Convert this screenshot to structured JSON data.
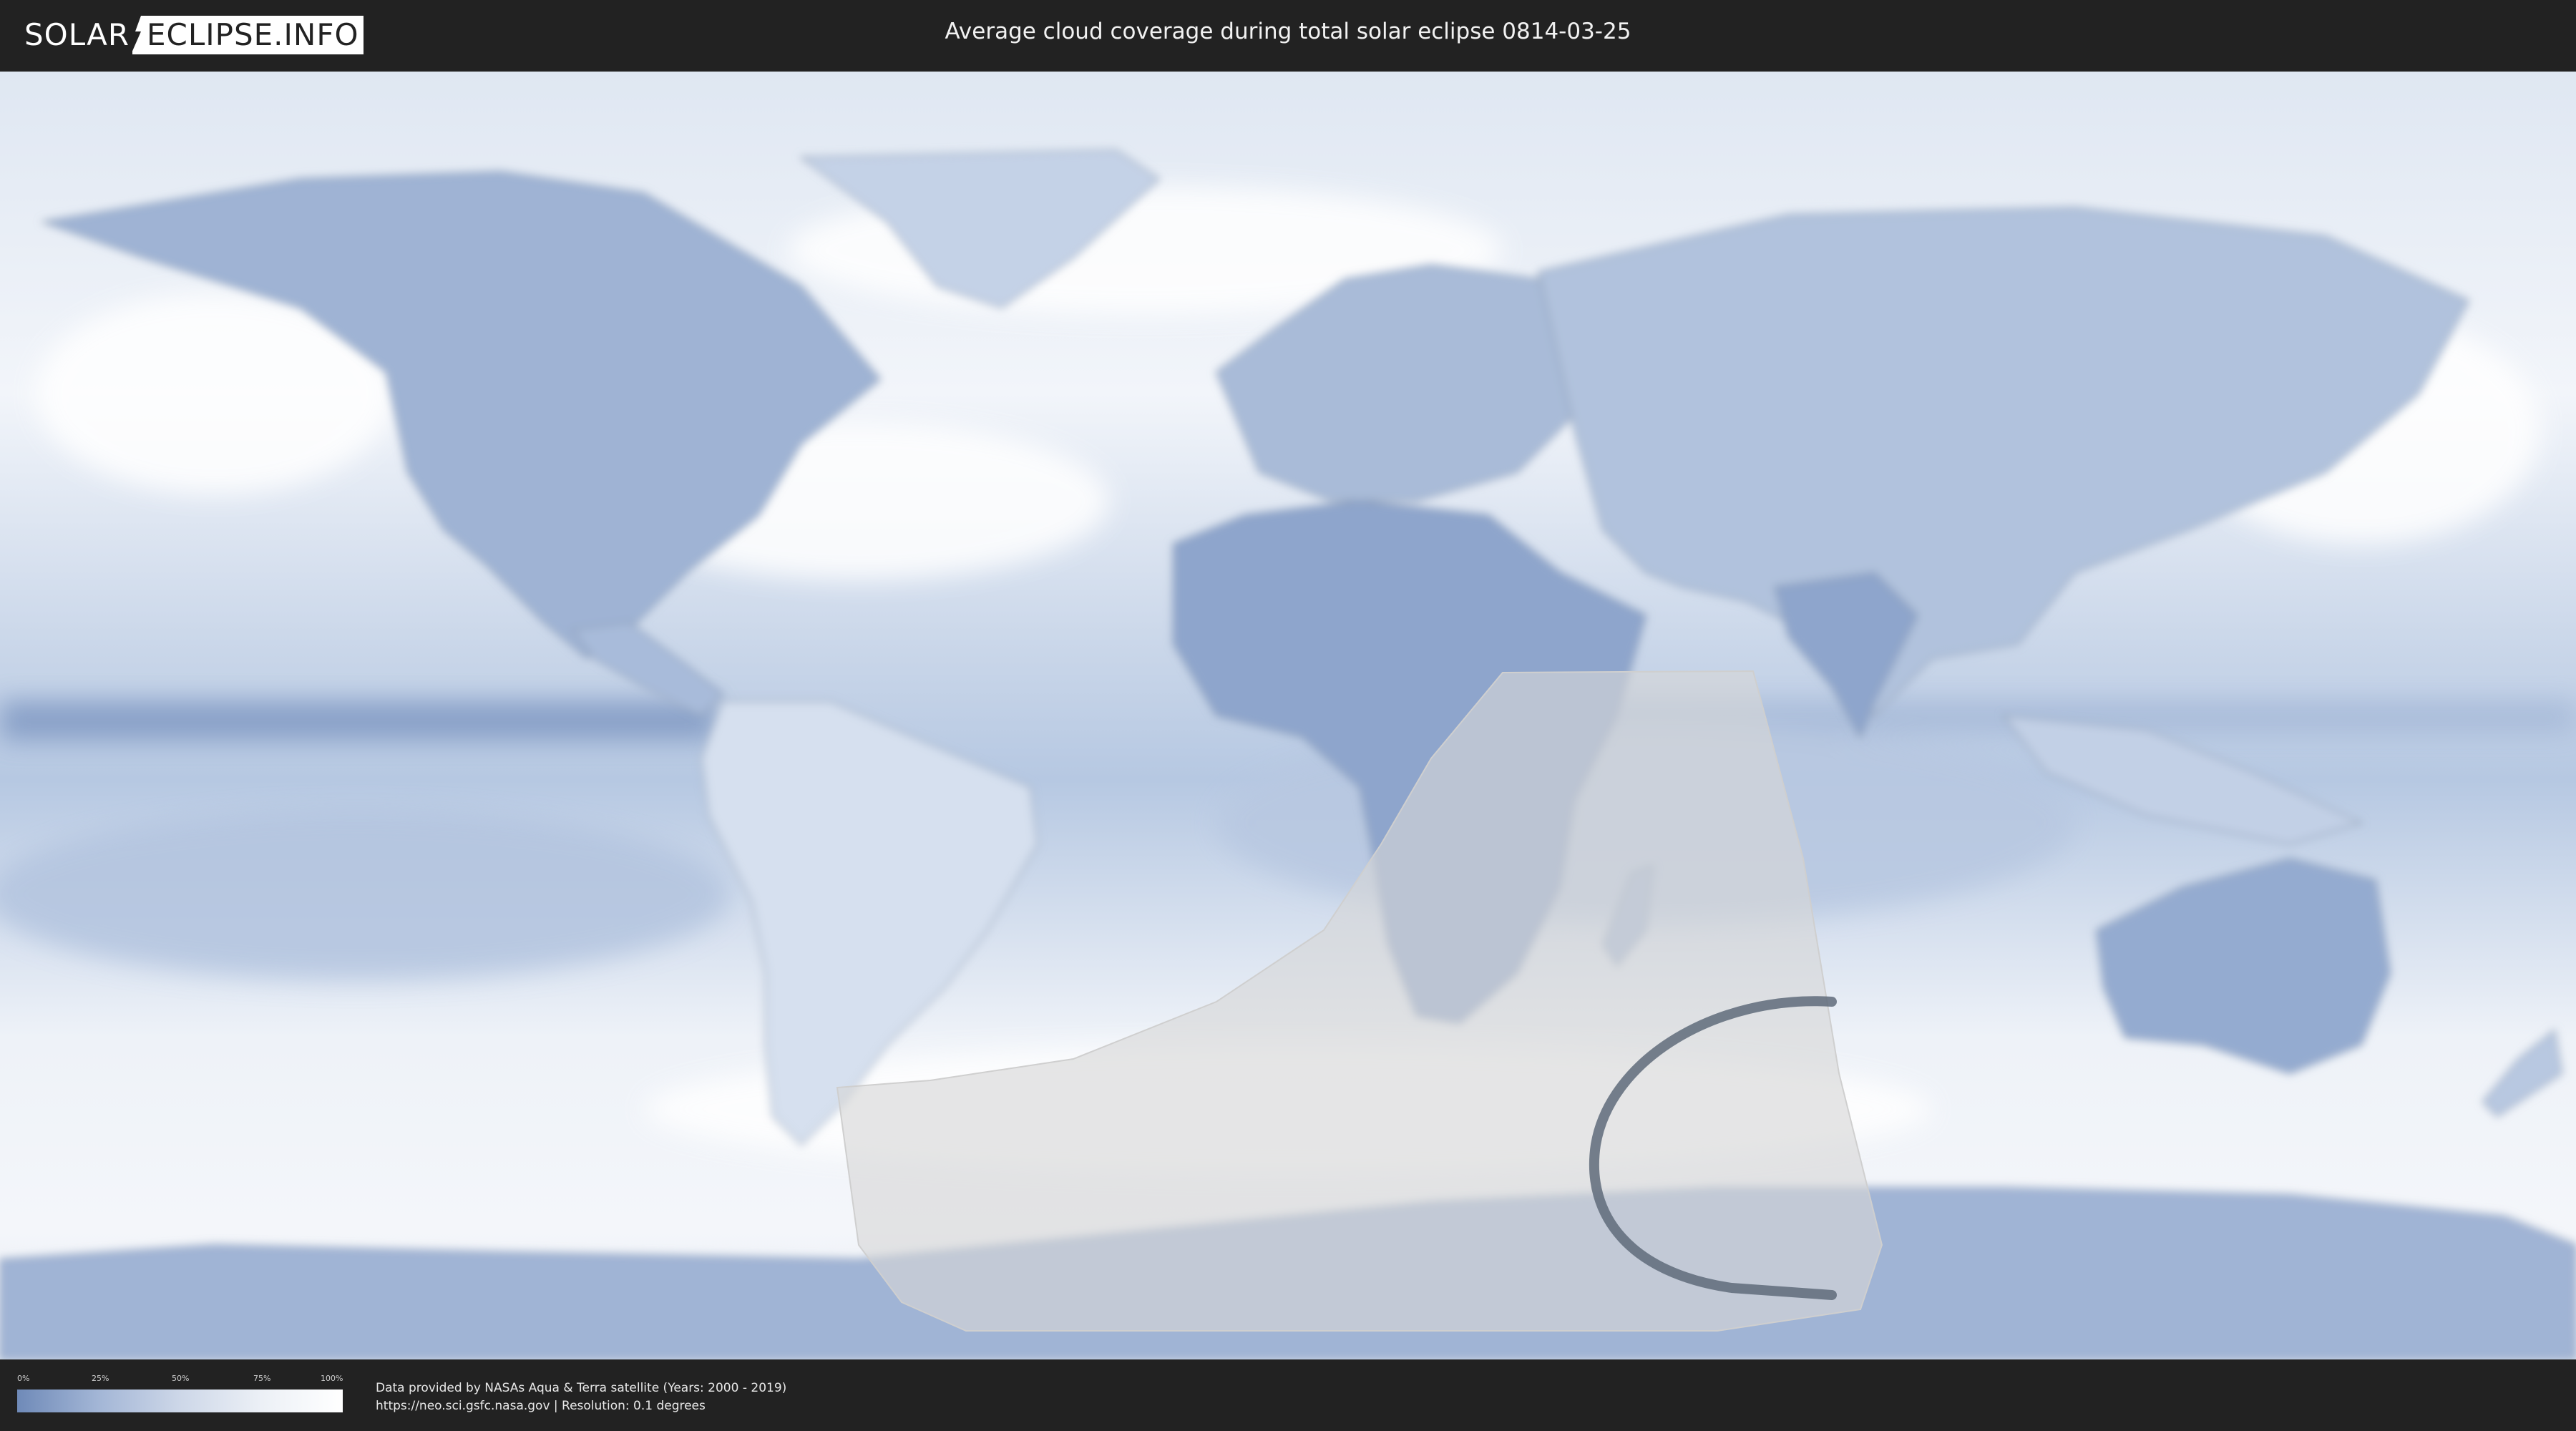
{
  "header": {
    "logo_left": "SOLAR",
    "logo_right": "ECLIPSE.INFO",
    "title": "Average cloud coverage during total solar eclipse 0814-03-25"
  },
  "map": {
    "projection": "equirectangular",
    "colors": {
      "ocean_cloud_light": "#eef2f8",
      "land_clear_blue": "#6f8ab8",
      "eclipse_zone": "#d9d9d9",
      "totality_path": "#5f6b7a",
      "borders": "#8797ad"
    },
    "icons": {
      "eclipse_visibility_zone": "shaded-region-icon",
      "totality_path": "path-line-icon"
    }
  },
  "legend": {
    "ticks": [
      "0%",
      "25%",
      "50%",
      "75%",
      "100%"
    ],
    "gradient_colors": [
      "#6f8ab8",
      "#a3b6d6",
      "#cdd7e8",
      "#ecf0f6",
      "#ffffff"
    ]
  },
  "credits": {
    "line1": "Data provided by NASAs Aqua & Terra satellite (Years: 2000 - 2019)",
    "line2": "https://neo.sci.gsfc.nasa.gov | Resolution: 0.1 degrees"
  }
}
